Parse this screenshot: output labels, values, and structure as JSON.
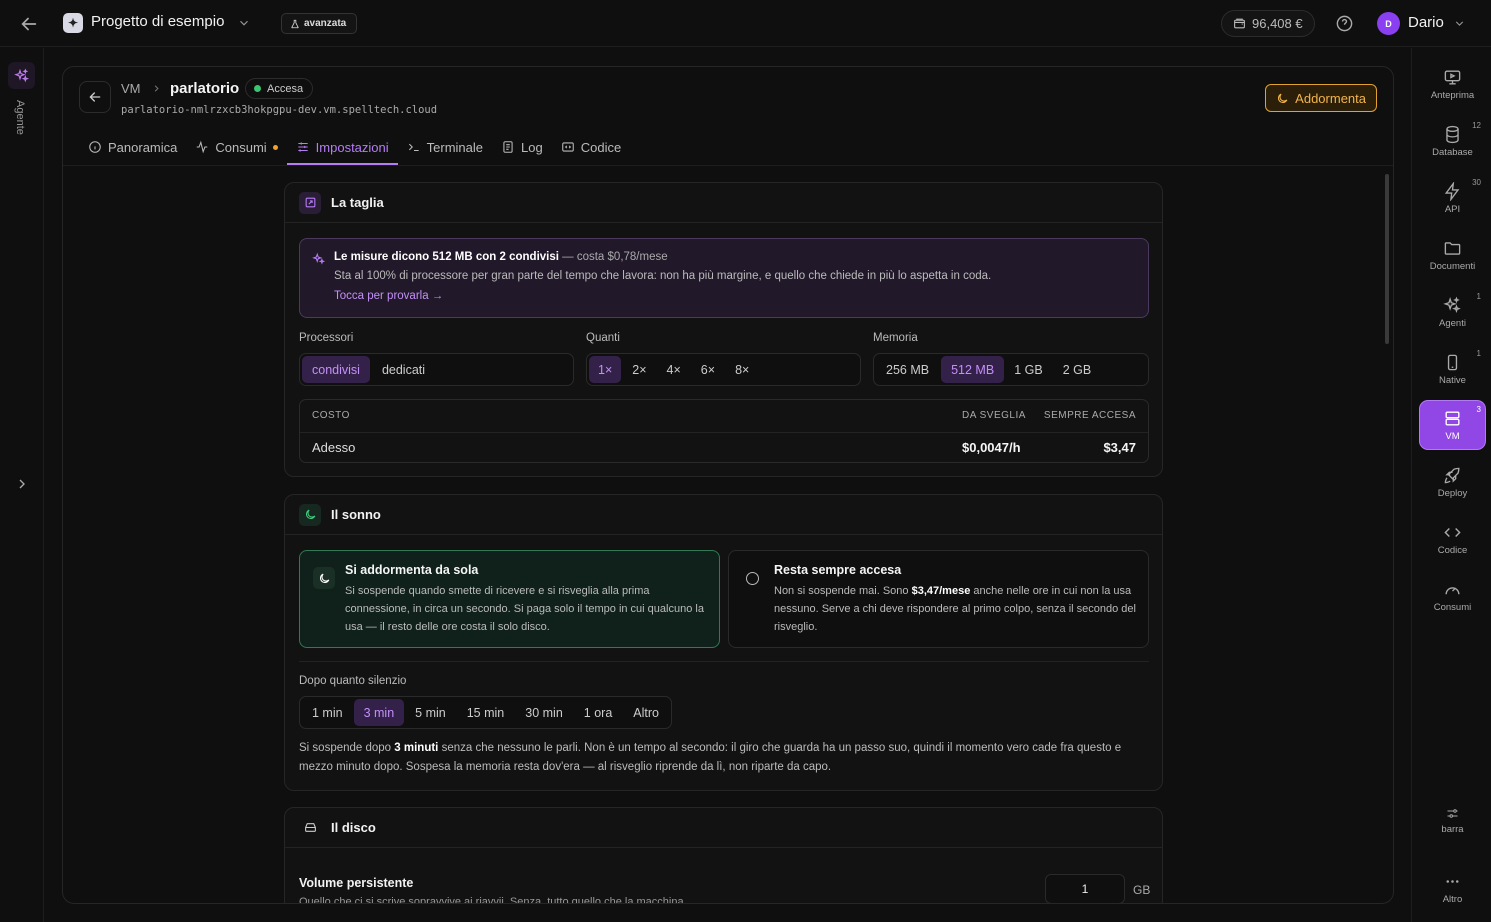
{
  "topbar": {
    "project_name": "Progetto di esempio",
    "mode_badge": "avanzata",
    "credit": "96,408 €",
    "user_initial": "D",
    "user_name": "Dario"
  },
  "left_rail": {
    "agent_label": "Agente"
  },
  "right_rail": {
    "items": [
      {
        "label": "Anteprima",
        "icon": "monitor-icon",
        "count": ""
      },
      {
        "label": "Database",
        "icon": "database-icon",
        "count": "12"
      },
      {
        "label": "API",
        "icon": "bolt-icon",
        "count": "30"
      },
      {
        "label": "Documenti",
        "icon": "folder-icon",
        "count": ""
      },
      {
        "label": "Agenti",
        "icon": "sparkles-icon",
        "count": "1"
      },
      {
        "label": "Native",
        "icon": "phone-icon",
        "count": "1"
      },
      {
        "label": "VM",
        "icon": "server-icon",
        "count": "3"
      },
      {
        "label": "Deploy",
        "icon": "rocket-icon",
        "count": ""
      },
      {
        "label": "Codice",
        "icon": "code-icon",
        "count": ""
      },
      {
        "label": "Consumi",
        "icon": "gauge-icon",
        "count": ""
      }
    ],
    "bottom": [
      {
        "label": "barra",
        "icon": "sliders-icon"
      },
      {
        "label": "Altro",
        "icon": "more-icon"
      }
    ]
  },
  "vm": {
    "crumb": "VM",
    "name": "parlatorio",
    "state": "Accesa",
    "host": "parlatorio-nmlrzxcb3hokpgpu-dev.vm.spelltech.cloud",
    "sleep_button": "Addormenta"
  },
  "tabs": [
    {
      "label": "Panoramica",
      "icon": "info-icon"
    },
    {
      "label": "Consumi",
      "icon": "activity-icon"
    },
    {
      "label": "Impostazioni",
      "icon": "sliders-icon"
    },
    {
      "label": "Terminale",
      "icon": "terminal-icon"
    },
    {
      "label": "Log",
      "icon": "log-icon"
    },
    {
      "label": "Codice",
      "icon": "code-icon"
    }
  ],
  "size_card": {
    "title": "La taglia",
    "hint_title": "Le misure dicono 512 MB con 2 condivisi",
    "hint_cost": " — costa $0,78/mese",
    "hint_desc": "Sta al 100% di processore per gran parte del tempo che lavora: non ha più margine, e quello che chiede in più lo aspetta in coda.",
    "hint_link": "Tocca per provarla →",
    "processors_label": "Processori",
    "processors": [
      "condivisi",
      "dedicati"
    ],
    "quantity_label": "Quanti",
    "quantities": [
      "1×",
      "2×",
      "4×",
      "6×",
      "8×"
    ],
    "memory_label": "Memoria",
    "memories": [
      "256 MB",
      "512 MB",
      "1 GB",
      "2 GB"
    ],
    "cost": {
      "h_label": "COSTO",
      "h_wake": "DA SVEGLIA",
      "h_always": "SEMPRE ACCESA",
      "row_label": "Adesso",
      "row_wake": "$0,0047/h",
      "row_always": "$3,47"
    }
  },
  "sleep_card": {
    "title": "Il sonno",
    "auto_title": "Si addormenta da sola",
    "auto_desc": "Si sospende quando smette di ricevere e si risveglia alla prima connessione, in circa un secondo. Si paga solo il tempo in cui qualcuno la usa — il resto delle ore costa il solo disco.",
    "always_title": "Resta sempre accesa",
    "always_desc_1": "Non si sospende mai. Sono ",
    "always_desc_b": "$3,47/mese",
    "always_desc_2": " anche nelle ore in cui non la usa nessuno. Serve a chi deve rispondere al primo colpo, senza il secondo del risveglio.",
    "delay_label": "Dopo quanto silenzio",
    "delays": [
      "1 min",
      "3 min",
      "5 min",
      "15 min",
      "30 min",
      "1 ora",
      "Altro"
    ],
    "note_1": "Si sospende dopo ",
    "note_b": "3 minuti",
    "note_2": " senza che nessuno le parli. Non è un tempo al secondo: il giro che guarda ha un passo suo, quindi il momento vero cade fra questo e mezzo minuto dopo. Sospesa la memoria resta dov'era — al risveglio riprende da lì, non riparte da capo."
  },
  "disk_card": {
    "title": "Il disco",
    "volume_title": "Volume persistente",
    "volume_desc": "Quello che ci si scrive sopravvive ai riavvii. Senza, tutto quello che la macchina",
    "volume_value": "1",
    "volume_unit": "GB"
  },
  "colors": {
    "accent": "#b57df5",
    "active_rail": "#9147e6",
    "warning": "#f2b44a",
    "success": "#39c46f"
  }
}
